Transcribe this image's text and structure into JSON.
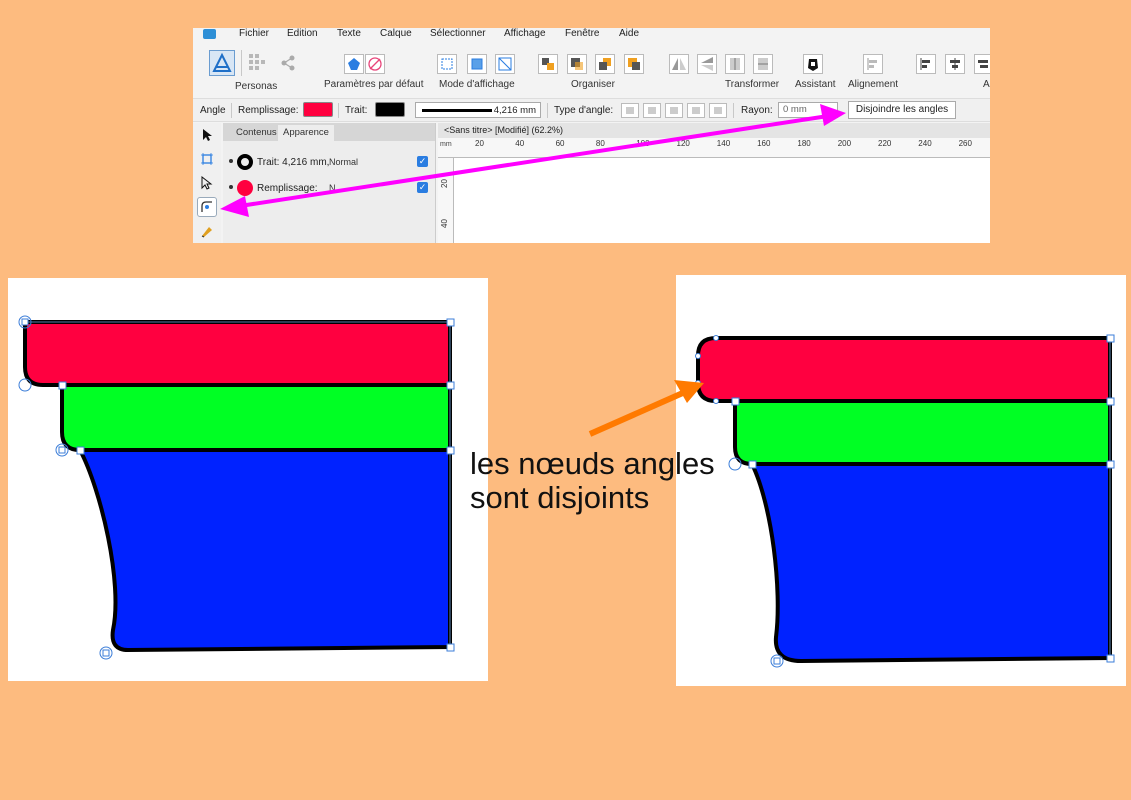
{
  "menubar": {
    "items": [
      "Fichier",
      "Edition",
      "Texte",
      "Calque",
      "Sélectionner",
      "Affichage",
      "Fenêtre",
      "Aide"
    ]
  },
  "toolbar": {
    "personas_label": "Personas",
    "defaults_label": "Paramètres par défaut",
    "view_mode_label": "Mode d'affichage",
    "arrange_label": "Organiser",
    "transform_label": "Transformer",
    "assistant_label": "Assistant",
    "alignment_label": "Alignement",
    "cut_label": "A"
  },
  "context": {
    "tool_label": "Angle",
    "fill_label": "Remplissage:",
    "fill_color": "#FF003F",
    "stroke_label": "Trait:",
    "stroke_color": "#000000",
    "stroke_width": "4,216 mm",
    "corner_type_label": "Type d'angle:",
    "radius_label": "Rayon:",
    "radius_value": "0 mm",
    "detach_button": "Disjoindre les angles"
  },
  "panel": {
    "tabs": [
      "Contenus",
      "Apparence"
    ],
    "stroke_row": "Trait: 4,216 mm,",
    "stroke_mode": "Normal",
    "fill_row": "Remplissage:",
    "fill_mode": "N"
  },
  "document": {
    "tab_title": "<Sans titre> [Modifié] (62.2%)",
    "ruler_unit": "mm",
    "h_ticks": [
      "20",
      "40",
      "60",
      "80",
      "100",
      "120",
      "140",
      "160",
      "180",
      "200",
      "220",
      "240",
      "260"
    ],
    "v_ticks": [
      "20",
      "40"
    ]
  },
  "annotation": {
    "line1": "les nœuds angles",
    "line2": "sont disjoints"
  },
  "colors": {
    "background": "#FDBB7F",
    "red": "#FF0040",
    "green": "#00FF24",
    "blue": "#0022FF",
    "magenta_arrow": "#FF00FF",
    "orange_arrow": "#FF7A00"
  },
  "icons": [
    "personas-icon",
    "grid-icon",
    "share-icon",
    "defaults-icon",
    "view-mode-icon",
    "arrange-icon",
    "transform-icon",
    "assistant-icon",
    "alignment-icon",
    "move-tool-icon",
    "artboard-tool-icon",
    "node-tool-icon",
    "corner-tool-icon",
    "pen-tool-icon"
  ]
}
